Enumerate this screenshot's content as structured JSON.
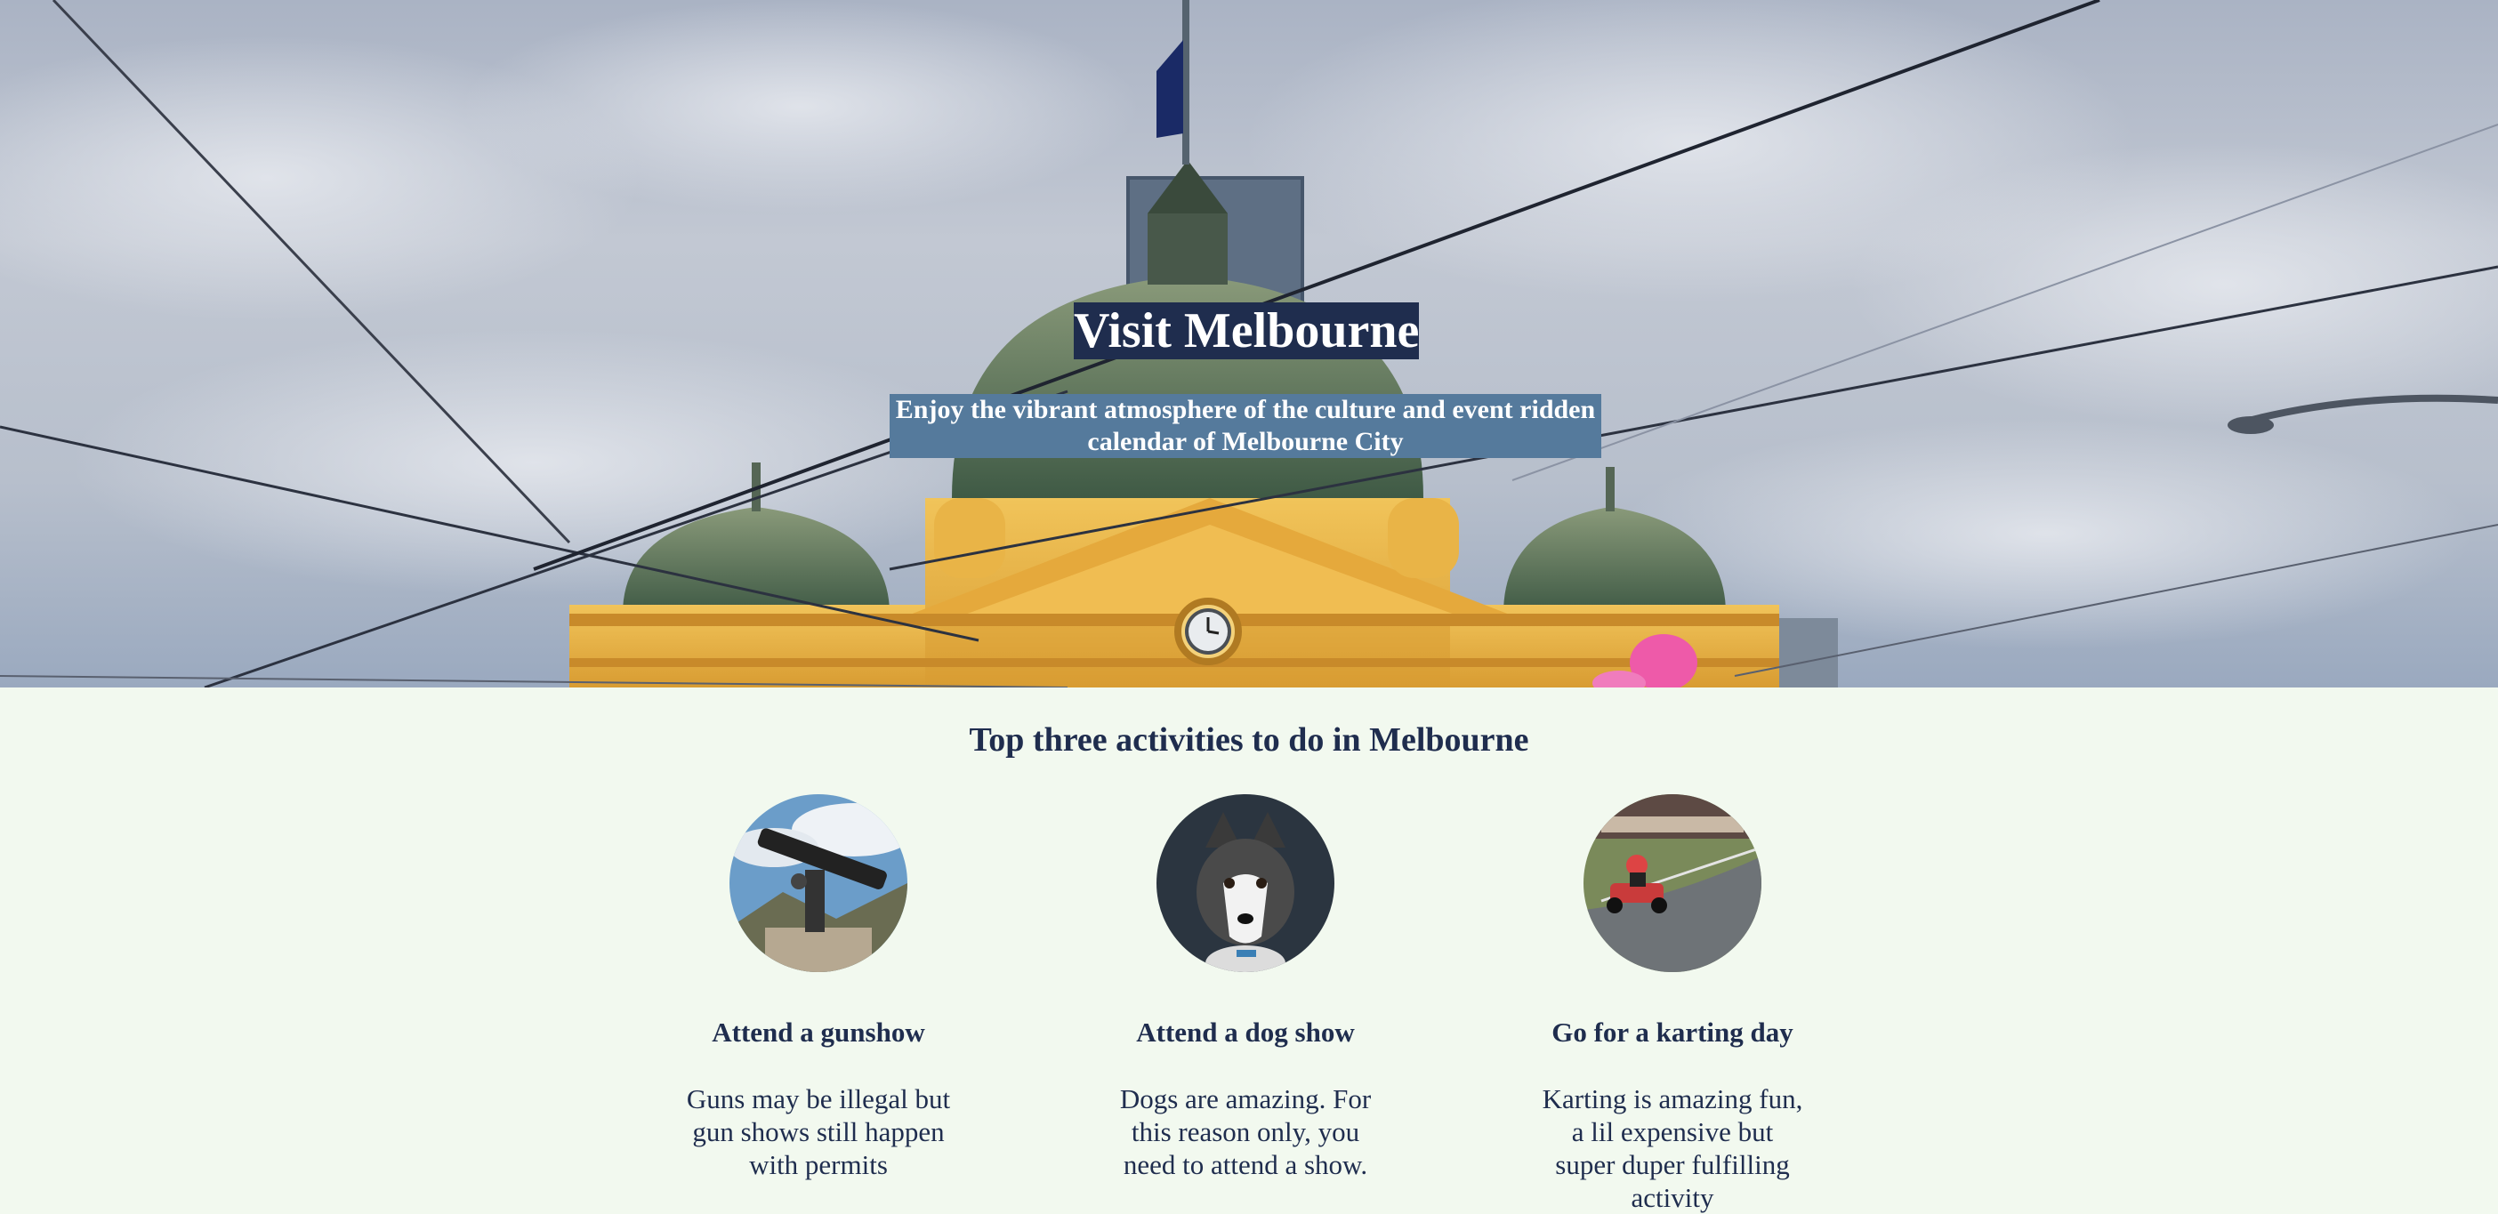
{
  "hero": {
    "title": "Visit Melbourne",
    "subtitle": "Enjoy the vibrant atmosphere of the culture and event ridden calendar of Melbourne City",
    "title_bg": "#1f2d4e",
    "subtitle_bg": "#557a9c"
  },
  "activities": {
    "heading": "Top three activities to do in Melbourne",
    "items": [
      {
        "title": "Attend a gunshow",
        "description": "Guns may be illegal but gun shows still happen with permits",
        "icon": "rifle-photo"
      },
      {
        "title": "Attend a dog show",
        "description": "Dogs are amazing. For this reason only, you need to attend a show.",
        "icon": "husky-photo"
      },
      {
        "title": "Go for a karting day",
        "description": "Karting is amazing fun, a lil expensive but super duper fulfilling activity",
        "icon": "go-kart-photo"
      }
    ]
  },
  "colors": {
    "page_background": "#f2f9ef",
    "text": "#1f2d4e"
  }
}
